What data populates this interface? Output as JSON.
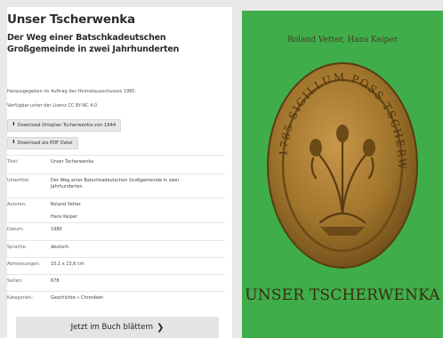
{
  "page": {
    "title": "Unser Tscherwenka",
    "subtitle": "Der Weg einer Batschkadeutschen Großgemeinde in zwei Jahrhunderten",
    "published_by": "Herausgegeben im Auftrag des Heimatausschusses 1980.",
    "license": "Verfügbar unter der Lizenz CC BY-NC 4.0."
  },
  "buttons": {
    "download_plan": "Download Ortsplan Tscherwenka von 1944",
    "download_pdf": "Download als PDF Datei",
    "browse": "Jetzt im Buch blättern"
  },
  "meta": [
    {
      "key": "Titel:",
      "values": [
        "Unser Tscherwenka"
      ]
    },
    {
      "key": "Untertitel:",
      "values": [
        "Der Weg einer Batschkadeutschen Großgemeinde in zwei",
        "Jahrhunderten"
      ]
    },
    {
      "key": "Autoren:",
      "values": [
        "Roland Vetter",
        "Hans Keiper"
      ]
    },
    {
      "key": "Datum:",
      "values": [
        "1980"
      ]
    },
    {
      "key": "Sprache:",
      "values": [
        "deutsch"
      ]
    },
    {
      "key": "Abmessungen:",
      "values": [
        "15,1 x 23,6 cm"
      ]
    },
    {
      "key": "Seiten:",
      "values": [
        "678"
      ]
    },
    {
      "key": "Kategorien:",
      "values": [
        "Geschichte  »  Chroniken"
      ]
    }
  ],
  "cover": {
    "authors": "Roland Vetter, Hans Keiper",
    "title": "UNSER TSCHERWENKA",
    "seal_text": "1785 SIGILLUM POSS TSCHERWENKU",
    "bg_color": "#3fae4a",
    "seal_color": "#a0742b"
  },
  "icons": {
    "download": "download-icon",
    "chevron": "chevron-right-icon"
  }
}
